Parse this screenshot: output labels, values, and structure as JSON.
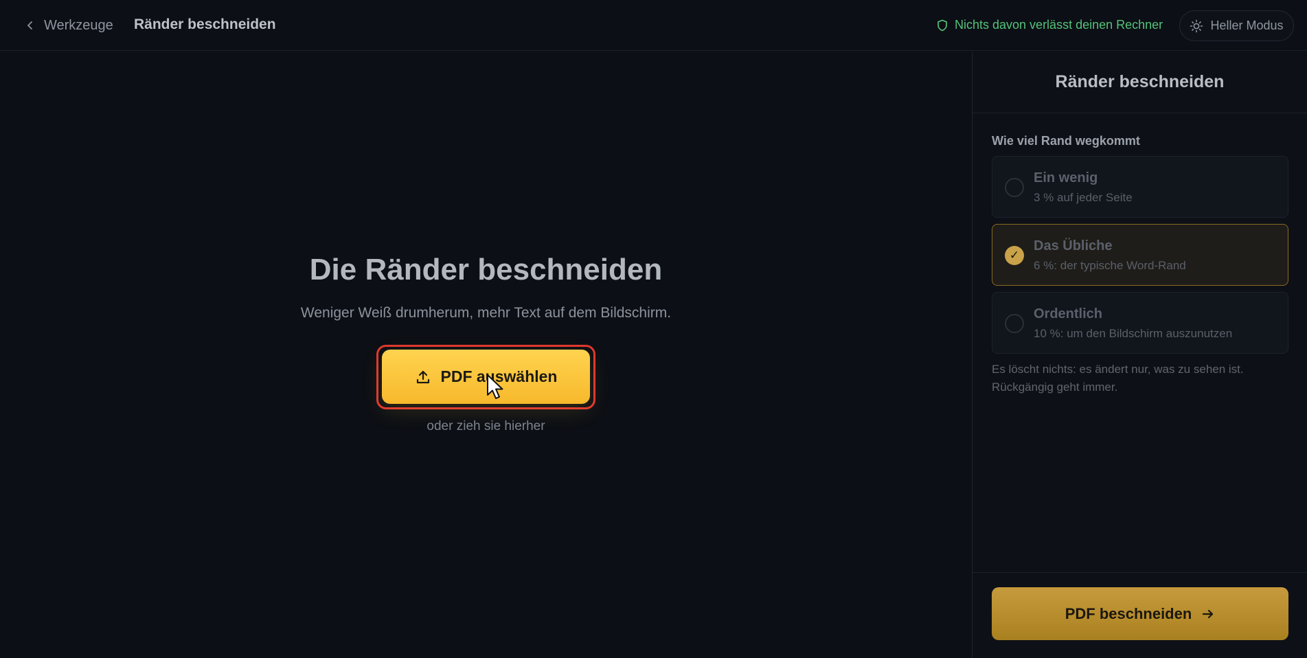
{
  "topbar": {
    "back_label": "Werkzeuge",
    "title": "Ränder beschneiden",
    "privacy_text": "Nichts davon verlässt deinen Rechner",
    "mode_label": "Heller Modus"
  },
  "hero": {
    "title": "Die Ränder beschneiden",
    "subtitle": "Weniger Weiß drumherum, mehr Text auf dem Bildschirm.",
    "upload_label": "PDF auswählen",
    "drop_hint": "oder zieh sie hierher"
  },
  "panel": {
    "title": "Ränder beschneiden",
    "section_label": "Wie viel Rand wegkommt",
    "options": [
      {
        "title": "Ein wenig",
        "desc": "3 % auf jeder Seite"
      },
      {
        "title": "Das Übliche",
        "desc": "6 %: der typische Word-Rand"
      },
      {
        "title": "Ordentlich",
        "desc": "10 %: um den Bildschirm auszunutzen"
      }
    ],
    "selected_index": 1,
    "note": "Es löscht nichts: es ändert nur, was zu sehen ist. Rückgängig geht immer.",
    "crop_label": "PDF beschneiden"
  },
  "colors": {
    "accent": "#f7b92c",
    "privacy_green": "#55c27a",
    "highlight_outline": "#e0362f"
  }
}
